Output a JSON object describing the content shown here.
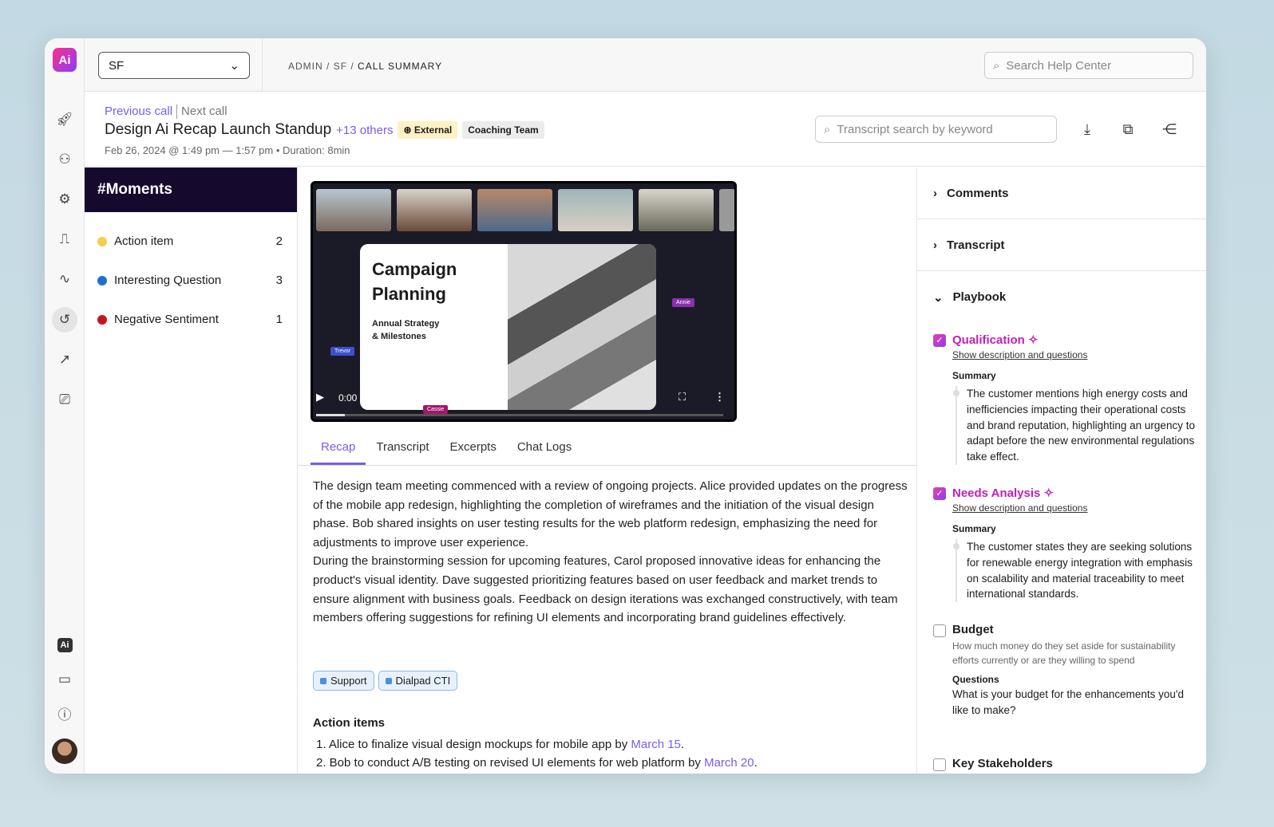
{
  "rail": {
    "logo": "Ai",
    "icons": [
      "rocket-icon",
      "user-icon",
      "gear-icon",
      "chart-ai-icon",
      "activity-icon",
      "history-icon",
      "trending-icon",
      "video-settings-icon",
      "ai-icon",
      "video-icon",
      "help-icon",
      "avatar"
    ]
  },
  "topbar": {
    "selector": "SF",
    "breadcrumb": {
      "admin": "ADMIN",
      "sep1": " / ",
      "sf": "SF",
      "sep2": " / ",
      "current": "CALL SUMMARY"
    },
    "search_placeholder": "Search Help Center"
  },
  "header": {
    "previous": "Previous call",
    "next": "Next call",
    "title": "Design Ai Recap Launch Standup",
    "others": "+13 others",
    "badges": [
      "External",
      "Coaching Team"
    ],
    "meta": "Feb 26, 2024 @ 1:49 pm — 1:57 pm • Duration: 8min",
    "transcript_search_placeholder": "Transcript search by keyword"
  },
  "moments": {
    "title": "#Moments",
    "items": [
      {
        "label": "Action item",
        "count": "2",
        "color": "#f7cd4f"
      },
      {
        "label": "Interesting Question",
        "count": "3",
        "color": "#1f6fd1"
      },
      {
        "label": "Negative Sentiment",
        "count": "1",
        "color": "#c8141e"
      }
    ]
  },
  "video": {
    "slide_title_1": "Campaign",
    "slide_title_2": "Planning",
    "slide_sub_1": "Annual Strategy",
    "slide_sub_2": "& Milestones",
    "cursors": [
      "Trevor",
      "Annie",
      "Cassie"
    ],
    "time": "0:00",
    "progress_percent": 7
  },
  "tabs": [
    "Recap",
    "Transcript",
    "Excerpts",
    "Chat Logs"
  ],
  "recap": {
    "p1": "The design team meeting commenced with a review of ongoing projects. Alice provided updates on the progress of the mobile app redesign, highlighting the completion of wireframes and the initiation of the visual design phase. Bob shared insights on user testing results for the web platform redesign, emphasizing the need for adjustments to improve user experience.",
    "p2": "During the brainstorming session for upcoming features, Carol proposed innovative ideas for enhancing the product's visual identity. Dave suggested prioritizing features based on user feedback and market trends to ensure alignment with business goals. Feedback on design iterations was exchanged constructively, with team members offering suggestions for refining UI elements and incorporating brand guidelines effectively.",
    "chips": [
      "Support",
      "Dialpad CTI"
    ],
    "action_title": "Action items",
    "actions": [
      {
        "text": "1. Alice to finalize visual design mockups for mobile app by ",
        "date": "March 15",
        "end": "."
      },
      {
        "text": "2. Bob to conduct A/B testing on revised UI elements for web platform by ",
        "date": "March 20",
        "end": "."
      }
    ]
  },
  "right": {
    "comments": "Comments",
    "transcript": "Transcript",
    "playbook": "Playbook",
    "items": [
      {
        "title": "Qualification",
        "link": "Show description and questions",
        "summary_label": "Summary",
        "summary": "The customer mentions high energy costs and inefficiencies impacting their operational costs and brand reputation, highlighting an urgency to adapt before the new environmental regulations take effect."
      },
      {
        "title": "Needs Analysis",
        "link": "Show description and questions",
        "summary_label": "Summary",
        "summary": "The customer states they are seeking solutions for renewable energy integration with emphasis on scalability and material traceability to meet international standards."
      },
      {
        "title": "Budget",
        "desc": "How much money do they set aside for sustainability efforts currently or are they willing to spend",
        "q_label": "Questions",
        "question": "What is your budget for the enhancements you'd like to make?"
      },
      {
        "title": "Key Stakeholders"
      }
    ]
  },
  "colors": {
    "accent": "#7c5ce6",
    "playbook_checked": "#c020b8",
    "moments_header": "#150a2e"
  }
}
